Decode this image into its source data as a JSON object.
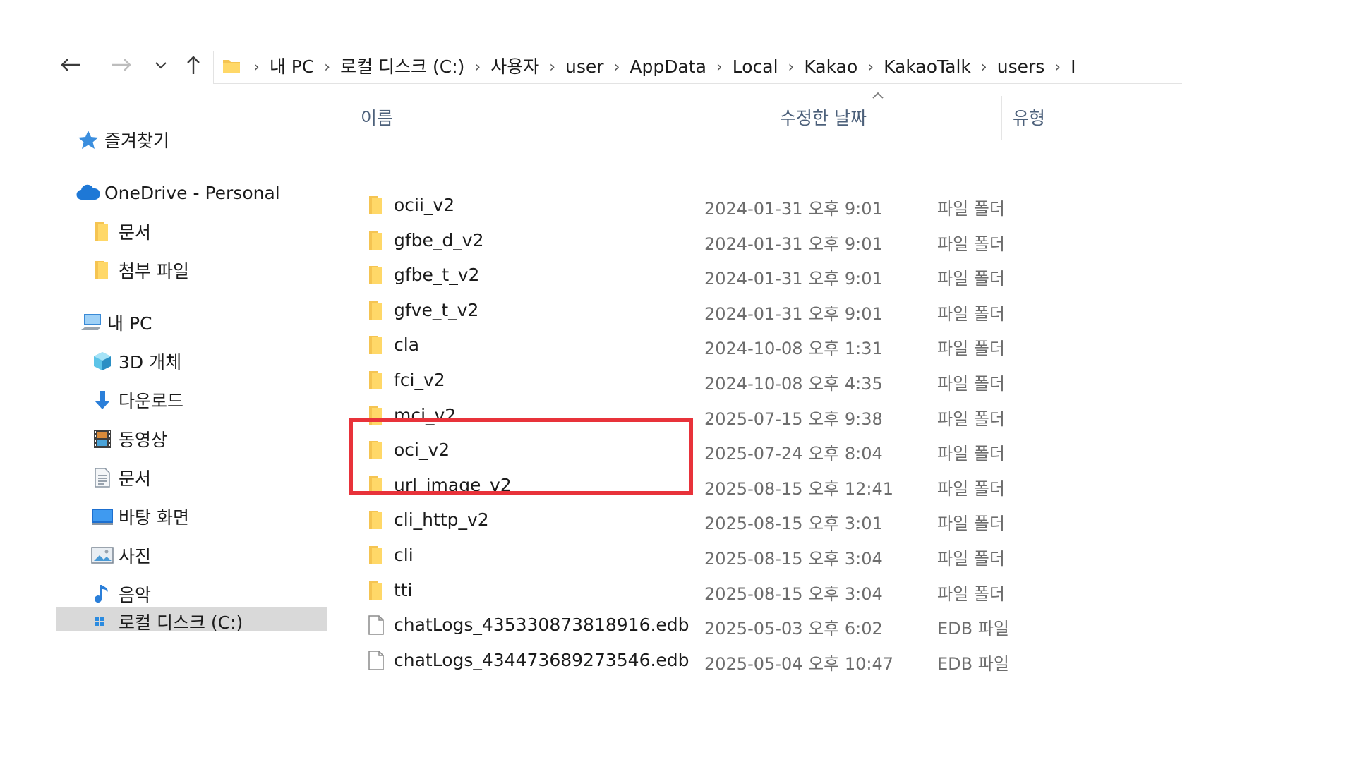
{
  "navbar": {
    "back_icon": "arrow-left-icon",
    "forward_icon": "arrow-right-icon",
    "recent_icon": "chevron-down-icon",
    "up_icon": "arrow-up-icon",
    "breadcrumbs": [
      "내 PC",
      "로컬 디스크 (C:)",
      "사용자",
      "user",
      "AppData",
      "Local",
      "Kakao",
      "KakaoTalk",
      "users",
      "I"
    ]
  },
  "sidebar": {
    "items": [
      {
        "label": "즐겨찾기",
        "icon": "star-icon"
      },
      {
        "label": "OneDrive - Personal",
        "icon": "cloud-icon"
      },
      {
        "label": "문서",
        "icon": "folder-icon"
      },
      {
        "label": "첨부 파일",
        "icon": "folder-icon"
      },
      {
        "label": "내 PC",
        "icon": "computer-icon"
      },
      {
        "label": "3D 개체",
        "icon": "cube-icon"
      },
      {
        "label": "다운로드",
        "icon": "download-icon"
      },
      {
        "label": "동영상",
        "icon": "film-icon"
      },
      {
        "label": "문서",
        "icon": "document-icon"
      },
      {
        "label": "바탕 화면",
        "icon": "desktop-icon"
      },
      {
        "label": "사진",
        "icon": "picture-icon"
      },
      {
        "label": "음악",
        "icon": "music-icon"
      },
      {
        "label": "로컬 디스크 (C:)",
        "icon": "drive-icon"
      }
    ]
  },
  "columns": {
    "name": "이름",
    "modified": "수정한 날짜",
    "type": "유형"
  },
  "files": [
    {
      "name": "ocii_v2",
      "date": "2024-01-31 오후 9:01",
      "type": "파일 폴더",
      "kind": "folder"
    },
    {
      "name": "gfbe_d_v2",
      "date": "2024-01-31 오후 9:01",
      "type": "파일 폴더",
      "kind": "folder"
    },
    {
      "name": "gfbe_t_v2",
      "date": "2024-01-31 오후 9:01",
      "type": "파일 폴더",
      "kind": "folder"
    },
    {
      "name": "gfve_t_v2",
      "date": "2024-01-31 오후 9:01",
      "type": "파일 폴더",
      "kind": "folder"
    },
    {
      "name": "cla",
      "date": "2024-10-08 오후 1:31",
      "type": "파일 폴더",
      "kind": "folder"
    },
    {
      "name": "fci_v2",
      "date": "2024-10-08 오후 4:35",
      "type": "파일 폴더",
      "kind": "folder"
    },
    {
      "name": "mci_v2",
      "date": "2025-07-15 오후 9:38",
      "type": "파일 폴더",
      "kind": "folder"
    },
    {
      "name": "oci_v2",
      "date": "2025-07-24 오후 8:04",
      "type": "파일 폴더",
      "kind": "folder"
    },
    {
      "name": "url_image_v2",
      "date": "2025-08-15 오후 12:41",
      "type": "파일 폴더",
      "kind": "folder"
    },
    {
      "name": "cli_http_v2",
      "date": "2025-08-15 오후 3:01",
      "type": "파일 폴더",
      "kind": "folder"
    },
    {
      "name": "cli",
      "date": "2025-08-15 오후 3:04",
      "type": "파일 폴더",
      "kind": "folder"
    },
    {
      "name": "tti",
      "date": "2025-08-15 오후 3:04",
      "type": "파일 폴더",
      "kind": "folder"
    },
    {
      "name": "chatLogs_435330873818916.edb",
      "date": "2025-05-03 오후 6:02",
      "type": "EDB 파일",
      "kind": "file"
    },
    {
      "name": "chatLogs_434473689273546.edb",
      "date": "2025-05-04 오후 10:47",
      "type": "EDB 파일",
      "kind": "file"
    }
  ],
  "annotation": {
    "color": "#e8323a"
  }
}
